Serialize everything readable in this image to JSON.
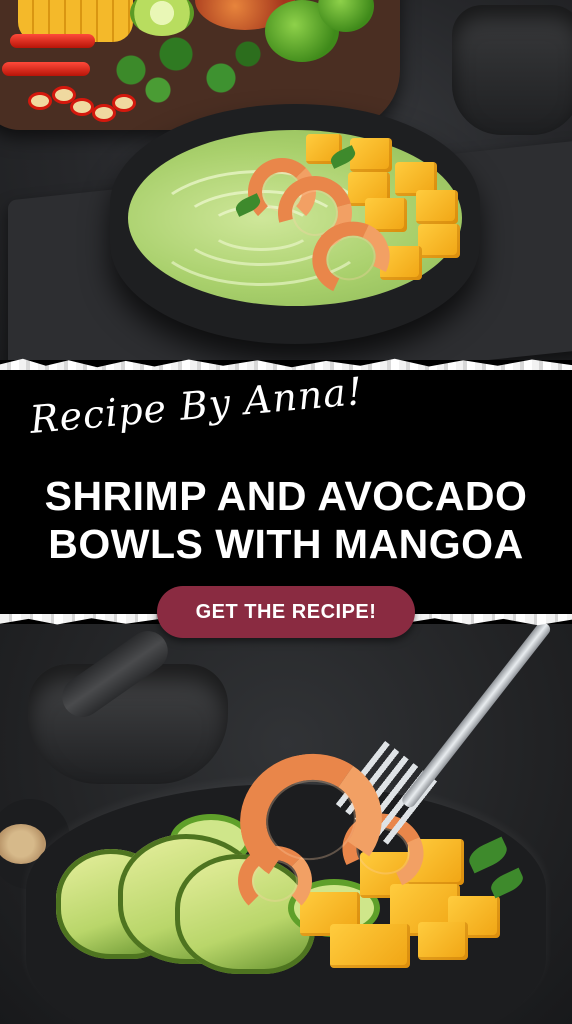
{
  "banner": {
    "byline": "Recipe By Anna!",
    "title_line1": "SHRIMP AND AVOCADO",
    "title_line2": "BOWLS WITH MANGOA",
    "cta_label": "GET THE RECIPE!"
  },
  "colors": {
    "banner_background": "#000000",
    "cta_background": "#8a2b41",
    "text": "#ffffff"
  },
  "images": {
    "top_photo": "shrimp-avocado-soup-bowl-with-mango",
    "bottom_photo": "shrimp-avocado-mango-bowl-with-fork"
  }
}
